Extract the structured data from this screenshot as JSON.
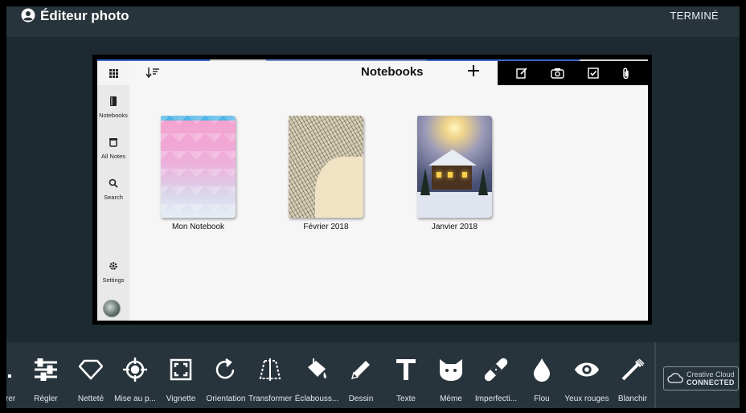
{
  "header": {
    "title": "Éditeur photo",
    "done_label": "TERMINÉ"
  },
  "app": {
    "title": "Notebooks",
    "sidebar": [
      {
        "label": "Notebooks",
        "icon": "notebook-icon"
      },
      {
        "label": "All Notes",
        "icon": "trash-icon"
      },
      {
        "label": "Search",
        "icon": "search-icon"
      },
      {
        "label": "Settings",
        "icon": "gear-icon"
      }
    ],
    "notebooks": [
      {
        "name": "Mon Notebook"
      },
      {
        "name": "Février 2018"
      },
      {
        "name": "Janvier 2018"
      }
    ]
  },
  "tools": [
    {
      "label": "lrer",
      "icon": "partial-tool-icon"
    },
    {
      "label": "Régler",
      "icon": "sliders-icon"
    },
    {
      "label": "Netteté",
      "icon": "diamond-icon"
    },
    {
      "label": "Mise au p...",
      "icon": "target-icon"
    },
    {
      "label": "Vignette",
      "icon": "vignette-icon"
    },
    {
      "label": "Orientation",
      "icon": "rotate-icon"
    },
    {
      "label": "Transformer",
      "icon": "transform-icon"
    },
    {
      "label": "Éclabouss...",
      "icon": "paint-bucket-icon"
    },
    {
      "label": "Dessin",
      "icon": "pencil-icon"
    },
    {
      "label": "Texte",
      "icon": "text-icon"
    },
    {
      "label": "Mème",
      "icon": "cat-icon"
    },
    {
      "label": "Imperfecti...",
      "icon": "bandage-icon"
    },
    {
      "label": "Flou",
      "icon": "drop-icon"
    },
    {
      "label": "Yeux rouges",
      "icon": "eye-icon"
    },
    {
      "label": "Blanchir",
      "icon": "brush-icon"
    }
  ],
  "creative_cloud": {
    "line1": "Creative Cloud",
    "line2": "CONNECTED"
  }
}
